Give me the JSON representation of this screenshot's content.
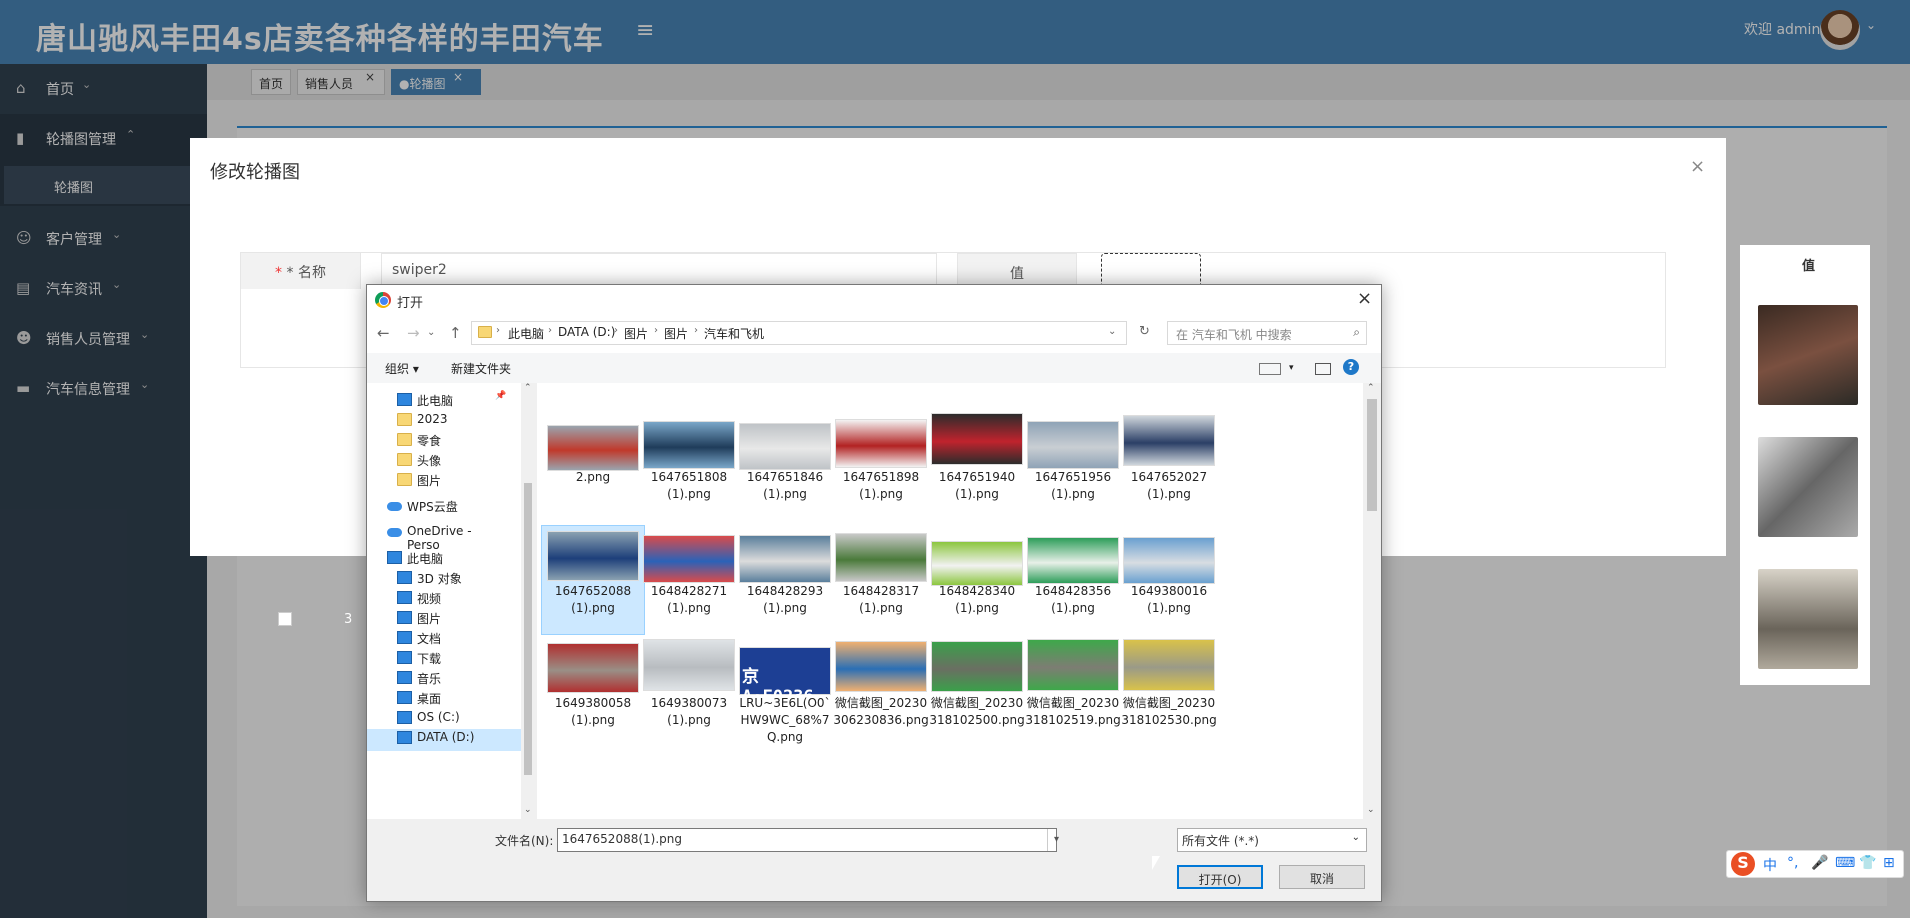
{
  "app": {
    "title": "唐山驰风丰田4s店卖各种各样的丰田汽车",
    "hamburger": "≡",
    "welcome": "欢迎 admin",
    "caret": "⌄"
  },
  "sidebar": {
    "items": [
      {
        "label": "首页",
        "icon": "home-icon",
        "glyph": "⌂"
      },
      {
        "label": "轮播图管理",
        "icon": "chart-icon",
        "glyph": "▮"
      },
      {
        "label": "客户管理",
        "icon": "user-icon",
        "glyph": "☺"
      },
      {
        "label": "汽车资讯",
        "icon": "list-icon",
        "glyph": "▤"
      },
      {
        "label": "销售人员管理",
        "icon": "person-icon",
        "glyph": "☻"
      },
      {
        "label": "汽车信息管理",
        "icon": "card-icon",
        "glyph": "▬"
      }
    ],
    "sub": "轮播图",
    "arrow_down": "⌄",
    "arrow_up": "⌃"
  },
  "tabs": [
    {
      "label": "首页"
    },
    {
      "label": "销售人员"
    },
    {
      "label": "●轮播图"
    }
  ],
  "tab_close": "×",
  "table": {
    "header": "值",
    "row_number": "3",
    "colors": [
      "#6b4a3a",
      "#999999",
      "#8a8478"
    ]
  },
  "modal": {
    "title": "修改轮播图",
    "close": "×",
    "name_label": "* 名称",
    "name_value": "swiper2",
    "value_label": "值"
  },
  "dialog": {
    "title": "打开",
    "close": "×",
    "nav": {
      "back": "←",
      "forward": "→",
      "down": "⌄",
      "up": "↑",
      "refresh": "↻",
      "dropdown": "⌄"
    },
    "path": [
      "此电脑",
      "DATA (D:)",
      "图片",
      "图片",
      "汽车和飞机"
    ],
    "search_placeholder": "在 汽车和飞机 中搜索",
    "toolbar": {
      "organize": "组织 ▾",
      "new_folder": "新建文件夹",
      "help": "?"
    },
    "tree": [
      {
        "label": "此电脑",
        "type": "pc"
      },
      {
        "label": "2023",
        "type": "folder"
      },
      {
        "label": "零食",
        "type": "folder"
      },
      {
        "label": "头像",
        "type": "folder"
      },
      {
        "label": "图片",
        "type": "folder"
      },
      {
        "label": "WPS云盘",
        "type": "cloud"
      },
      {
        "label": "OneDrive - Perso",
        "type": "cloud"
      },
      {
        "label": "此电脑",
        "type": "pc"
      },
      {
        "label": "3D 对象",
        "type": "cube"
      },
      {
        "label": "视频",
        "type": "video"
      },
      {
        "label": "图片",
        "type": "image"
      },
      {
        "label": "文档",
        "type": "doc"
      },
      {
        "label": "下载",
        "type": "download"
      },
      {
        "label": "音乐",
        "type": "music"
      },
      {
        "label": "桌面",
        "type": "desktop"
      },
      {
        "label": "OS (C:)",
        "type": "drive"
      },
      {
        "label": "DATA (D:)",
        "type": "drive"
      }
    ],
    "files": [
      {
        "name": "2.png",
        "c1": "#c0392b",
        "c2": "#9aa4ae"
      },
      {
        "name": "1647651808(1).png",
        "c1": "#1f3c5a",
        "c2": "#7aa7c9"
      },
      {
        "name": "1647651846(1).png",
        "c1": "#e8e8e8",
        "c2": "#bfc3c7"
      },
      {
        "name": "1647651898(1).png",
        "c1": "#b22222",
        "c2": "#f3f3f3"
      },
      {
        "name": "1647651940(1).png",
        "c1": "#c0232d",
        "c2": "#2c2c2c"
      },
      {
        "name": "1647651956(1).png",
        "c1": "#c9ced3",
        "c2": "#8fa3b6"
      },
      {
        "name": "1647652027(1).png",
        "c1": "#2b3f66",
        "c2": "#cfd6dc"
      },
      {
        "name": "1647652088(1).png",
        "c1": "#1d3f7a",
        "c2": "#8aa1b1"
      },
      {
        "name": "1648428271(1).png",
        "c1": "#2a62b8",
        "c2": "#d94b4b"
      },
      {
        "name": "1648428293(1).png",
        "c1": "#dcdcdc",
        "c2": "#5a7f9c"
      },
      {
        "name": "1648428317(1).png",
        "c1": "#4a7a3a",
        "c2": "#c8c8c8"
      },
      {
        "name": "1648428340(1).png",
        "c1": "#f2f2f2",
        "c2": "#8cc63f"
      },
      {
        "name": "1648428356(1).png",
        "c1": "#e8f0e8",
        "c2": "#2e9e5a"
      },
      {
        "name": "1649380016(1).png",
        "c1": "#d8dde2",
        "c2": "#6aa0d0"
      },
      {
        "name": "1649380058(1).png",
        "c1": "#9a8f86",
        "c2": "#b03030"
      },
      {
        "name": "1649380073(1).png",
        "c1": "#b8bcc0",
        "c2": "#dfe3e6"
      },
      {
        "name": "LRU~3E6L(O0`HW9WC_68%7Q.png",
        "c1": "#1d3f94",
        "c2": "#1d3f94",
        "plate": "京A·F0236"
      },
      {
        "name": "微信截图_20230306230836.png",
        "c1": "#2a6fb5",
        "c2": "#f0b070"
      },
      {
        "name": "微信截图_20230318102500.png",
        "c1": "#6a6f62",
        "c2": "#3aa04a"
      },
      {
        "name": "微信截图_20230318102519.png",
        "c1": "#7d7d73",
        "c2": "#3ea84a"
      },
      {
        "name": "微信截图_20230318102530.png",
        "c1": "#9a9a88",
        "c2": "#d9c24a"
      }
    ],
    "filename_label": "文件名(N):",
    "filename_value": "1647652088(1).png",
    "filetype": "所有文件 (*.*)",
    "open": "打开(O)",
    "cancel": "取消"
  },
  "ime": {
    "logo": "S",
    "icons": [
      "中",
      "°,",
      "🎤",
      "⌨",
      "👕",
      "⊞"
    ]
  }
}
